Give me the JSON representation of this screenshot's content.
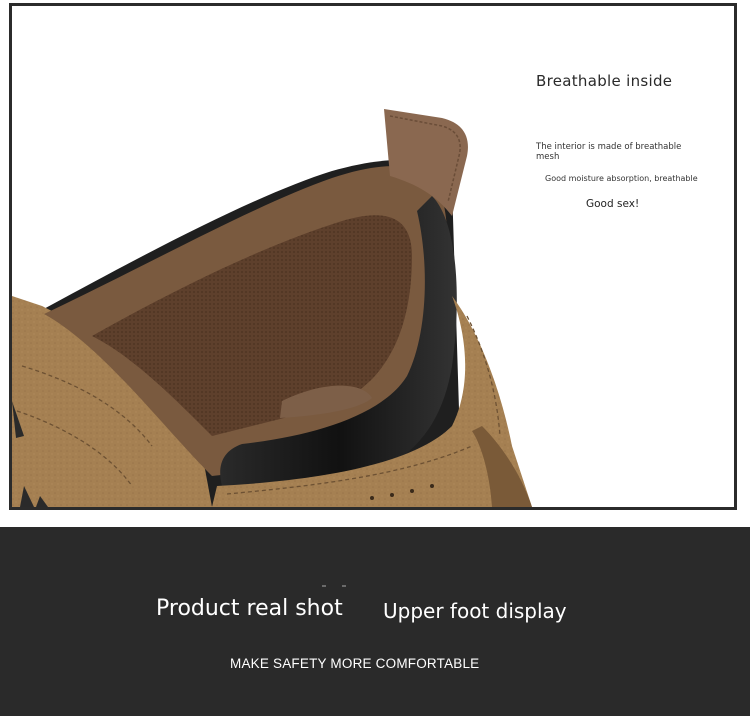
{
  "feature": {
    "title": "Breathable inside",
    "line1": "The interior is made of breathable mesh",
    "line2": "Good moisture absorption, breathable",
    "line3": "Good sex!"
  },
  "banner": {
    "title_left": "Product real shot",
    "title_right": "Upper foot display",
    "subtitle": "MAKE SAFETY MORE COMFORTABLE"
  },
  "colors": {
    "frame": "#2b2b2b",
    "banner_bg": "#2a2a2a",
    "suede": "#a07a4d",
    "mesh": "#6b4a33",
    "collar_black": "#1e1e1e"
  }
}
